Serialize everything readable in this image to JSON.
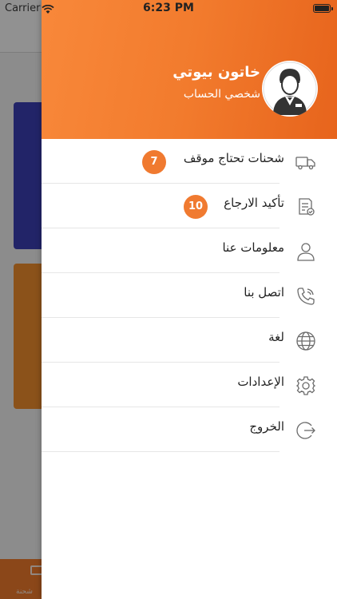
{
  "status_bar": {
    "carrier": "Carrier",
    "time": "6:23 PM"
  },
  "background": {
    "tab_label": "شحنة"
  },
  "drawer": {
    "user": {
      "name": "خاتون بيوتي",
      "subtitle": "شخصي الحساب"
    },
    "menu": [
      {
        "label": "شحنات تحتاج موقف",
        "icon": "truck-icon",
        "badge": "7"
      },
      {
        "label": "تأكيد الارجاع",
        "icon": "clipboard-check-icon",
        "badge": "10"
      },
      {
        "label": "معلومات عنا",
        "icon": "user-icon"
      },
      {
        "label": "اتصل بنا",
        "icon": "phone-icon"
      },
      {
        "label": "لغة",
        "icon": "globe-icon"
      },
      {
        "label": "الإعدادات",
        "icon": "gear-icon"
      },
      {
        "label": "الخروج",
        "icon": "logout-icon"
      }
    ]
  },
  "colors": {
    "accent": "#f07a30",
    "header_gradient_start": "#f8883a",
    "header_gradient_end": "#e7641c"
  }
}
